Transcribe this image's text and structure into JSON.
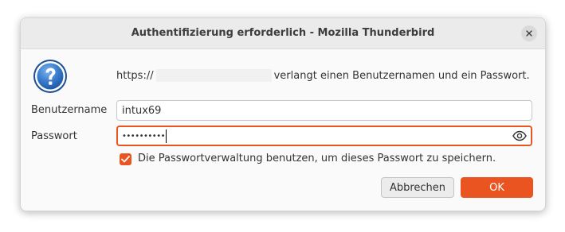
{
  "window": {
    "title": "Authentifizierung erforderlich - Mozilla Thunderbird",
    "close_icon": "close-icon"
  },
  "prompt": {
    "icon": "question-icon",
    "url_prefix": "https://",
    "message_suffix": "verlangt einen Benutzernamen und ein Passwort."
  },
  "form": {
    "username_label": "Benutzername",
    "username_value": "intux69",
    "password_label": "Passwort",
    "password_masked": "••••••••••",
    "reveal_icon": "eye-icon",
    "remember_checked": true,
    "remember_label": "Die Passwortverwaltung benutzen, um dieses Passwort zu speichern."
  },
  "buttons": {
    "cancel_label": "Abbrechen",
    "ok_label": "OK"
  },
  "colors": {
    "accent": "#e95420"
  }
}
